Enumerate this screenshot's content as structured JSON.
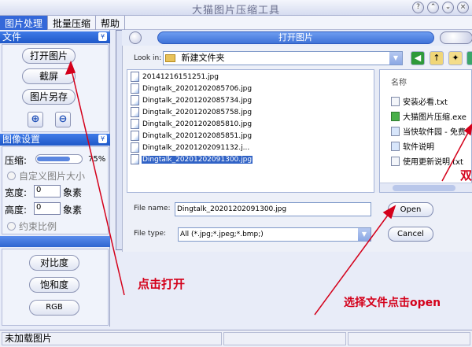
{
  "app": {
    "title": "大猫图片压缩工具"
  },
  "window_buttons": [
    {
      "name": "window-help-button",
      "glyph": "?"
    },
    {
      "name": "window-minimize-button",
      "glyph": "⌃"
    },
    {
      "name": "window-restore-button",
      "glyph": "⌄"
    },
    {
      "name": "window-close-button",
      "glyph": "×"
    }
  ],
  "menu": [
    {
      "label": "图片处理",
      "active": true
    },
    {
      "label": "批量压缩",
      "active": false
    },
    {
      "label": "帮助",
      "active": false
    }
  ],
  "sidebar": {
    "file_header": "文件",
    "open_button": "打开图片",
    "screenshot_button": "截屏",
    "save_as_button": "图片另存",
    "zoom_in_glyph": "⊕",
    "zoom_out_glyph": "⊖",
    "image_settings_header": "图像设置",
    "compress_label": "压缩:",
    "compress_value": "75%",
    "compress_fraction": 0.75,
    "custom_size_label": "自定义图片大小",
    "width_label": "宽度:",
    "width_value": "0",
    "width_unit": "象素",
    "height_label": "高度:",
    "height_value": "0",
    "height_unit": "象素",
    "constrain_label": "约束比例",
    "contrast_button": "对比度",
    "saturation_button": "饱和度",
    "rgb_button": "RGB",
    "chevron_glyph": "¥"
  },
  "status": {
    "text": "未加载图片"
  },
  "dialog": {
    "title": "打开图片",
    "look_in_label": "Look in:",
    "look_in_value": "新建文件夹",
    "files": [
      "20141216151251.jpg",
      "Dingtalk_20201202085706.jpg",
      "Dingtalk_20201202085734.jpg",
      "Dingtalk_20201202085758.jpg",
      "Dingtalk_20201202085810.jpg",
      "Dingtalk_20201202085851.jpg",
      "Dingtalk_20201202091132.j...",
      "Dingtalk_20201202091300.jpg"
    ],
    "selected_index": 7,
    "right_header": "名称",
    "right_items": [
      "安装必看.txt",
      "大猫图片压缩.exe",
      "当快软件园 - 免费",
      "软件说明",
      "使用更新说明.txt"
    ],
    "file_name_label": "File name:",
    "file_name_value": "Dingtalk_20201202091300.jpg",
    "file_type_label": "File type:",
    "file_type_value": "All (*.jpg;*.jpeg;*.bmp;)",
    "open_button": "Open",
    "cancel_button": "Cancel",
    "combo_arrow_glyph": "▼"
  },
  "annotations": {
    "click_open": "点击打开",
    "select_file": "选择文件点击open",
    "partial_right": "双",
    "color": "#d4001a"
  }
}
